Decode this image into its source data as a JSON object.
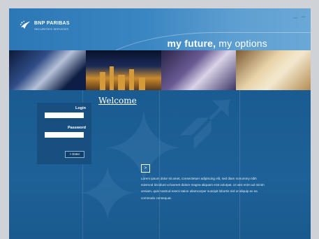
{
  "brand": {
    "name": "BNP PARIBAS",
    "subtitle": "SECURITIES SERVICES"
  },
  "header": {
    "tagline_bold": "my future,",
    "tagline_rest": " my options"
  },
  "login": {
    "login_label": "Login",
    "password_label": "Password",
    "enter_label": "> Enter"
  },
  "main": {
    "title": "Welcome",
    "arrow": ">",
    "text": "Lorem ipsum dolor sit amet, consectetuer adipiscing elit, sed diam nonummy nibh euismod tincidunt ut laoreet dolore magna aliquam erat volutpat. Ut wisi enim ad minim veniam, quis nostrud exerci tation ullamcorper suscipit lobortis nisl ut aliquip ex ea commodo consequat."
  },
  "colors": {
    "background": "#1b5e93",
    "header": "#3a86c2",
    "panel": "#174f80",
    "frame": "#cfd3d8"
  }
}
